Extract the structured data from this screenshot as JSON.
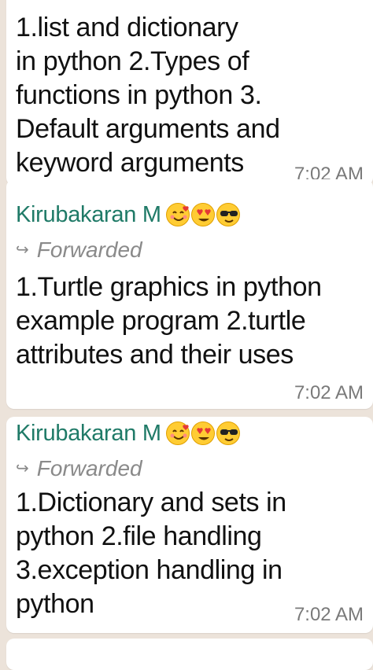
{
  "messages": [
    {
      "lines": [
        "1.list and dictionary",
        "in python 2.Types of",
        "functions in python 3.",
        "Default arguments and",
        "keyword arguments"
      ],
      "time": "7:02 AM"
    },
    {
      "sender": "Kirubakaran M",
      "forwarded": "Forwarded",
      "lines": [
        "1.Turtle graphics in python",
        "example program 2.turtle",
        "attributes and their uses"
      ],
      "time": "7:02 AM"
    },
    {
      "sender": "Kirubakaran M",
      "forwarded": "Forwarded",
      "lines": [
        "1.Dictionary and sets in",
        "python 2.file handling",
        "3.exception handling in",
        "python"
      ],
      "time": "7:02 AM"
    }
  ],
  "sender_emojis": [
    "smiling-face-with-hearts",
    "heart-eyes",
    "sunglasses"
  ],
  "colors": {
    "background": "#ece3da",
    "bubble": "#ffffff",
    "sender": "#1f7a67",
    "text": "#111111",
    "meta": "#7a7a7a"
  },
  "icons": {
    "forward": "↪"
  }
}
